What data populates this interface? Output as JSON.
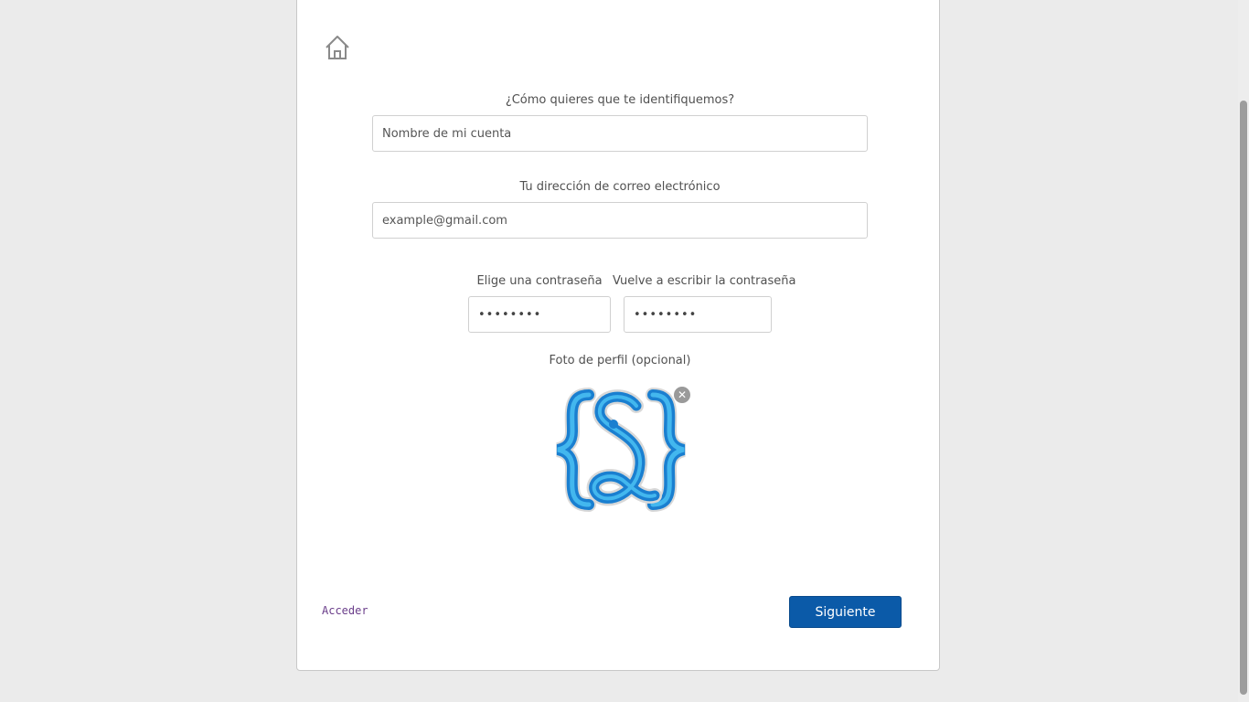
{
  "form": {
    "name_label": "¿Cómo quieres que te identifiquemos?",
    "name_placeholder": "Nombre de mi cuenta",
    "email_label": "Tu dirección de correo electrónico",
    "email_placeholder": "example@gmail.com",
    "password_label": "Elige una contraseña",
    "password_value": "••••••••",
    "confirm_label": "Vuelve a escribir la contraseña",
    "confirm_value": "••••••••",
    "photo_label": "Foto de perfil (opcional)",
    "remove_symbol": "✕"
  },
  "footer": {
    "login_link": "Acceder",
    "next_button": "Siguiente"
  },
  "icons": {
    "home": "home-icon",
    "avatar": "curly-braces-s-logo"
  },
  "colors": {
    "primary_button": "#0b5aa8",
    "link": "#6a3d8a",
    "logo_blue": "#1a8fd8"
  }
}
